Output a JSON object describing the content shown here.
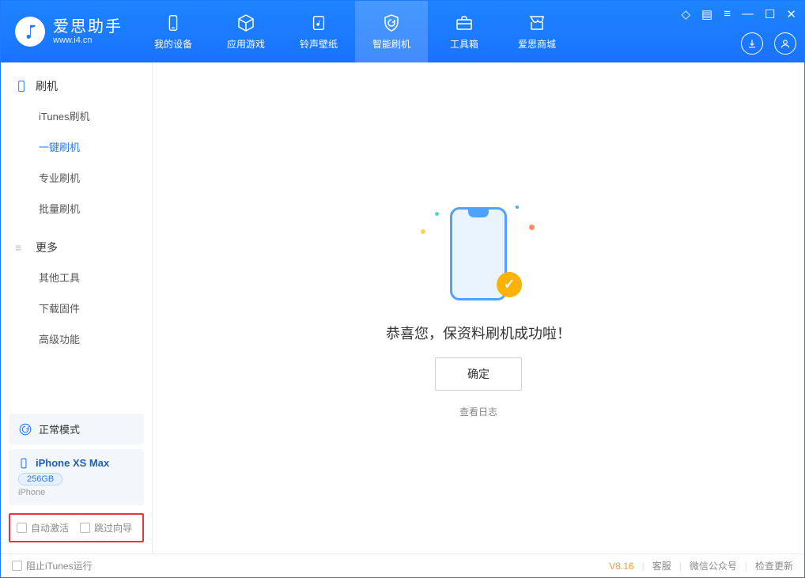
{
  "brand": {
    "name": "爱思助手",
    "url": "www.i4.cn"
  },
  "nav": {
    "items": [
      {
        "label": "我的设备"
      },
      {
        "label": "应用游戏"
      },
      {
        "label": "铃声壁纸"
      },
      {
        "label": "智能刷机"
      },
      {
        "label": "工具箱"
      },
      {
        "label": "爱思商城"
      }
    ]
  },
  "sidebar": {
    "section1": {
      "title": "刷机",
      "items": [
        {
          "label": "iTunes刷机"
        },
        {
          "label": "一键刷机"
        },
        {
          "label": "专业刷机"
        },
        {
          "label": "批量刷机"
        }
      ]
    },
    "section2": {
      "title": "更多",
      "items": [
        {
          "label": "其他工具"
        },
        {
          "label": "下载固件"
        },
        {
          "label": "高级功能"
        }
      ]
    },
    "mode": "正常模式",
    "device": {
      "name": "iPhone XS Max",
      "storage": "256GB",
      "type": "iPhone"
    },
    "opts": {
      "auto_activate": "自动激活",
      "skip_guide": "跳过向导"
    }
  },
  "main": {
    "message": "恭喜您，保资料刷机成功啦！",
    "ok": "确定",
    "log": "查看日志"
  },
  "footer": {
    "block_itunes": "阻止iTunes运行",
    "version": "V8.16",
    "links": {
      "support": "客服",
      "wechat": "微信公众号",
      "update": "检查更新"
    }
  }
}
